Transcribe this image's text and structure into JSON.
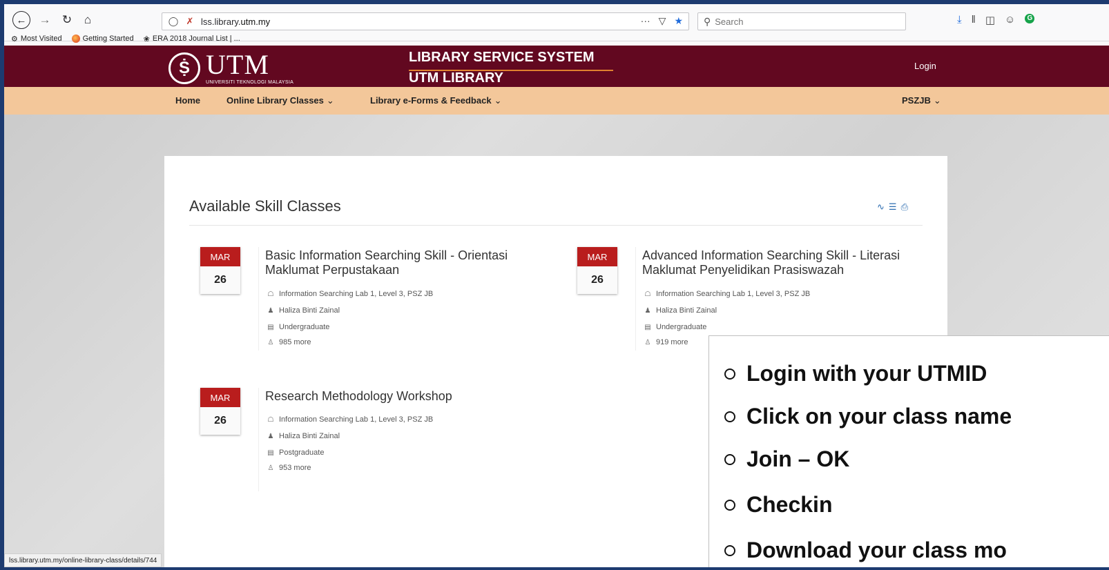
{
  "browser": {
    "url_plain": "lss.library.",
    "url_domain": "utm.my",
    "search_placeholder": "Search",
    "url_more": "···",
    "status_url": "lss.library.utm.my/online-library-class/details/744"
  },
  "bookmarks": [
    "Most Visited",
    "Getting Started",
    "ERA 2018 Journal List | ..."
  ],
  "header": {
    "logo_word": "UTM",
    "logo_sub": "UNIVERSITI TEKNOLOGI MALAYSIA",
    "system_title": "LIBRARY SERVICE SYSTEM",
    "system_sub": "UTM LIBRARY",
    "login": "Login"
  },
  "nav": {
    "home": "Home",
    "classes": "Online Library Classes",
    "forms": "Library e-Forms & Feedback",
    "branch": "PSZJB"
  },
  "section_title": "Available Skill Classes",
  "events": [
    {
      "month": "MAR",
      "day": "26",
      "title": "Basic Information Searching Skill - Orientasi Maklumat Perpustakaan",
      "location": "Information Searching Lab 1, Level 3, PSZ JB",
      "instructor": "Haliza Binti Zainal",
      "level": "Undergraduate",
      "attendees": "985 more"
    },
    {
      "month": "MAR",
      "day": "26",
      "title": "Advanced Information Searching Skill - Literasi Maklumat Penyelidikan Prasiswazah",
      "location": "Information Searching Lab 1, Level 3, PSZ JB",
      "instructor": "Haliza Binti Zainal",
      "level": "Undergraduate",
      "attendees": "919 more"
    },
    {
      "month": "MAR",
      "day": "26",
      "title": "Research Methodology Workshop",
      "location": "Information Searching Lab 1, Level 3, PSZ JB",
      "instructor": "Haliza Binti Zainal",
      "level": "Postgraduate",
      "attendees": "953 more"
    }
  ],
  "instructions": [
    "Login with your UTMID",
    "Click on your class name",
    "Join – OK",
    "Checkin",
    "Download your class mo"
  ],
  "colors": {
    "header": "#620820",
    "navbar": "#f3c79a",
    "date_badge": "#b91d1d",
    "frame": "#1d3b70"
  }
}
